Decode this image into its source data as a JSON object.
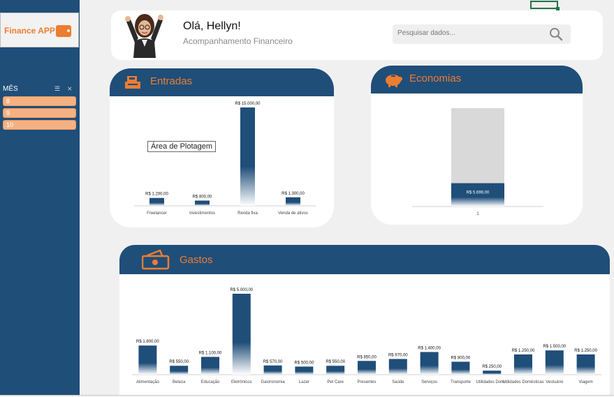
{
  "app": {
    "name": "Finance APP",
    "brand_color": "#ed7d31",
    "primary_color": "#1f4e79"
  },
  "slicer": {
    "title": "MÊS",
    "items": [
      "8",
      "9",
      "10"
    ]
  },
  "header": {
    "greeting": "Olá, Hellyn!",
    "subtitle": "Acompanhamento Financeiro",
    "search_placeholder": "Pesquisar dados..."
  },
  "entradas": {
    "title": "Entradas",
    "plot_area_label": "Área de Plotagem",
    "chart_data": {
      "type": "bar",
      "categories": [
        "Freelancer",
        "Investimentos",
        "Renda fixa",
        "Venda de ativos"
      ],
      "values": [
        1200,
        800,
        15000,
        1300
      ],
      "data_labels": [
        "R$ 1.200,00",
        "R$ 800,00",
        "R$ 15.000,00",
        "R$ 1.300,00"
      ],
      "ylim": [
        0,
        15000
      ]
    }
  },
  "economias": {
    "title": "Economias",
    "chart_data": {
      "type": "bar",
      "categories": [
        "1"
      ],
      "values": [
        5699
      ],
      "data_labels": [
        "R$ 5.699,00"
      ],
      "background_bar": true,
      "ylim": [
        0,
        24000
      ]
    }
  },
  "gastos": {
    "title": "Gastos",
    "chart_data": {
      "type": "bar",
      "categories": [
        "Alimentação",
        "Beleza",
        "Educação",
        "Eletrônicos",
        "Gastronomia",
        "Lazer",
        "Pet Care",
        "Presentes",
        "Saúde",
        "Serviços",
        "Transporte",
        "Utilidades Dom...",
        "Utilidades Domésticas",
        "Vestuário",
        "Viagem"
      ],
      "values": [
        1800,
        550,
        1100,
        5000,
        570,
        500,
        550,
        850,
        970,
        1400,
        800,
        250,
        1250,
        1500,
        1250
      ],
      "data_labels": [
        "R$ 1.800,00",
        "R$ 550,00",
        "R$ 1.100,00",
        "R$ 5.000,00",
        "R$ 570,00",
        "R$ 500,00",
        "R$ 550,00",
        "R$ 850,00",
        "R$ 970,00",
        "R$ 1.400,00",
        "R$ 800,00",
        "R$ 250,00",
        "R$ 1.250,00",
        "R$ 1.500,00",
        "R$ 1.250,00"
      ],
      "ylim": [
        0,
        5000
      ]
    }
  }
}
